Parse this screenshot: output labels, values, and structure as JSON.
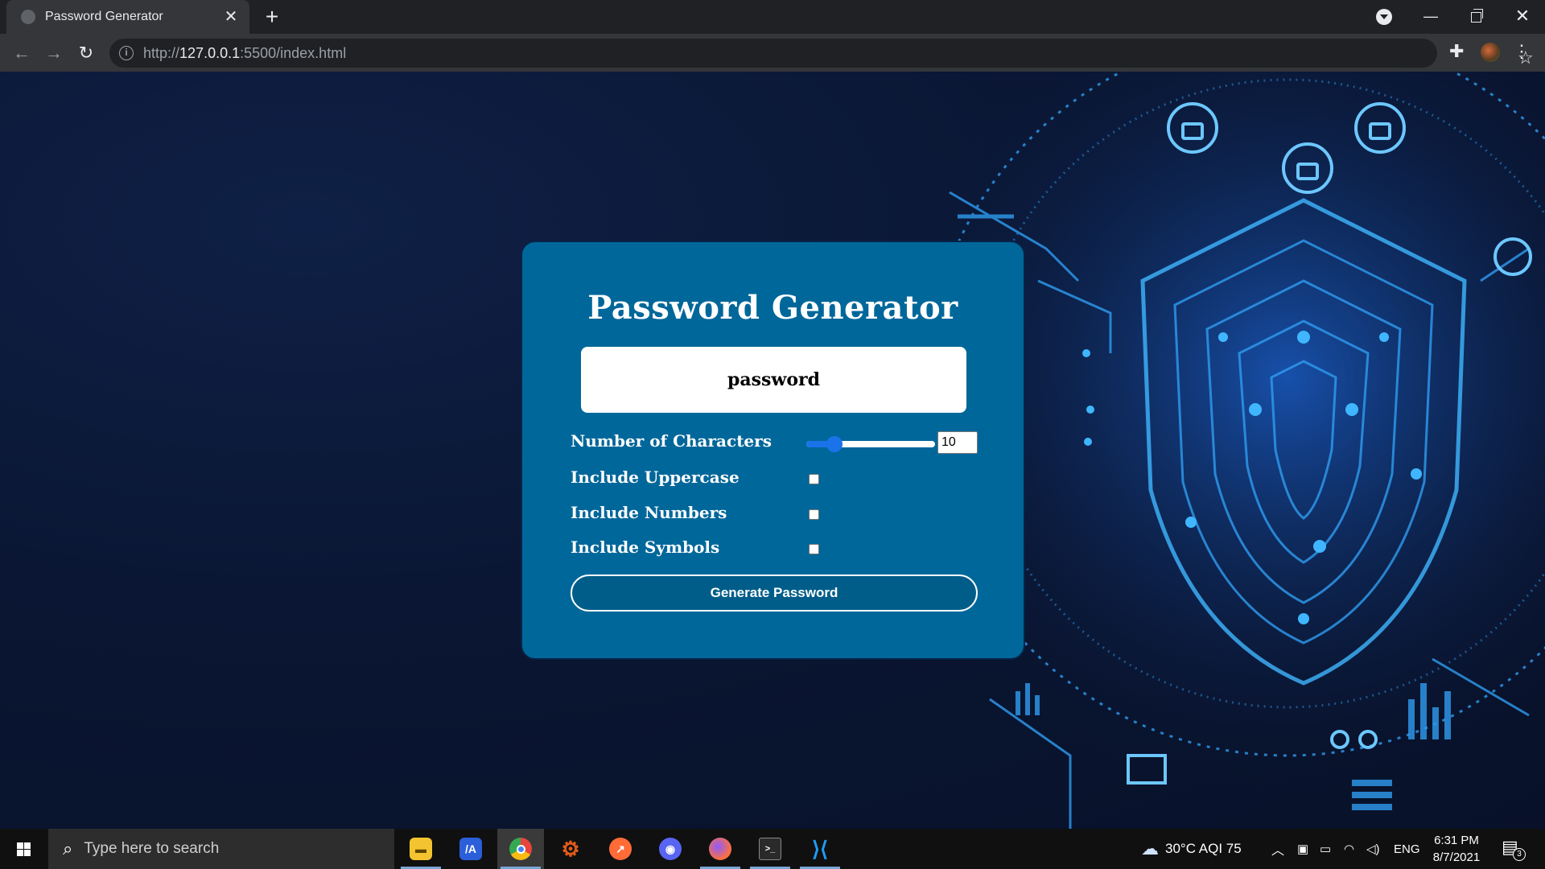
{
  "browser": {
    "tab_title": "Password Generator",
    "url_scheme": "http://",
    "url_host": "127.0.0.1",
    "url_path": ":5500/index.html"
  },
  "app": {
    "title": "Password Generator",
    "password_display": "password",
    "chars_label": "Number of Characters",
    "chars_value": "10",
    "chars_slider_level": 0.22,
    "uppercase_label": "Include Uppercase",
    "uppercase_checked": false,
    "numbers_label": "Include Numbers",
    "numbers_checked": false,
    "symbols_label": "Include Symbols",
    "symbols_checked": false,
    "generate_label": "Generate Password"
  },
  "taskbar": {
    "search_placeholder": "Type here to search",
    "apps": [
      {
        "name": "file-explorer-icon",
        "color": "#f4c430"
      },
      {
        "name": "app-icon",
        "color": "#2b5fd9"
      },
      {
        "name": "chrome-icon",
        "color": "#e8453c"
      },
      {
        "name": "settings-icon",
        "color": "#e05a1a"
      },
      {
        "name": "postman-icon",
        "color": "#ff6c37"
      },
      {
        "name": "discord-icon",
        "color": "#5865f2"
      },
      {
        "name": "firefox-icon",
        "color": "#ff7139"
      },
      {
        "name": "terminal-icon",
        "color": "#2a2a2a"
      },
      {
        "name": "vscode-icon",
        "color": "#1f9cf0"
      }
    ],
    "weather": "30°C  AQI 75",
    "language": "ENG",
    "time": "6:31 PM",
    "date": "8/7/2021",
    "notifications": "3"
  },
  "colors": {
    "card": "#00679a",
    "page_bg": "#0a1633",
    "accent": "#1a73e8"
  }
}
